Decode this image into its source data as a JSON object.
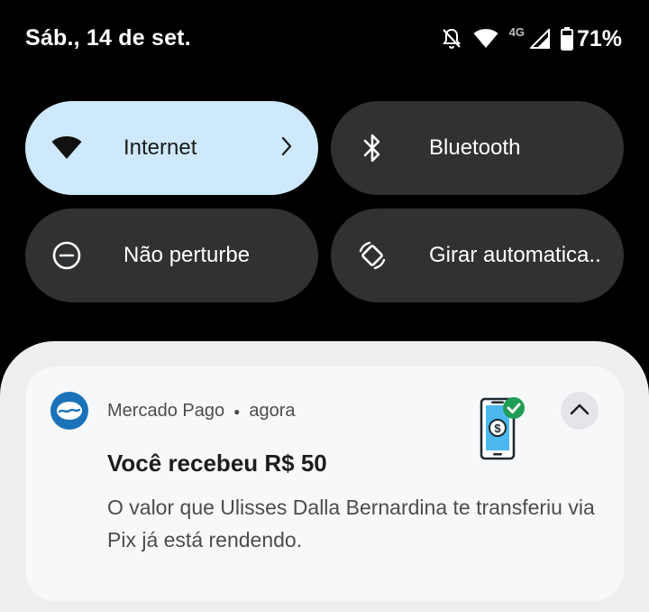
{
  "status_bar": {
    "date": "Sáb., 14 de set.",
    "network_type": "4G",
    "battery": "71%",
    "icons": [
      "bell-off-icon",
      "wifi-icon",
      "cell-signal-icon",
      "battery-icon"
    ]
  },
  "quick_settings": {
    "tiles": [
      {
        "label": "Internet",
        "icon": "wifi-icon",
        "state": "active"
      },
      {
        "label": "Bluetooth",
        "icon": "bluetooth-icon",
        "state": "inactive"
      },
      {
        "label": "Não perturbe",
        "icon": "do-not-disturb-icon",
        "state": "inactive"
      },
      {
        "label": "Girar automatica..",
        "icon": "auto-rotate-icon",
        "state": "inactive"
      }
    ]
  },
  "notification": {
    "app_name": "Mercado Pago",
    "time": "agora",
    "title": "Você recebeu R$ 50",
    "body": "O valor que Ulisses Dalla Bernardina te transferiu via Pix já está rendendo.",
    "icon": "mercado-pago-icon",
    "image": "phone-money-check-icon"
  },
  "colors": {
    "active_tile": "#cde9fb",
    "inactive_tile": "#2f3133",
    "panel": "#eceef0",
    "card": "#f7f8fa",
    "brand": "#1a73b8"
  }
}
